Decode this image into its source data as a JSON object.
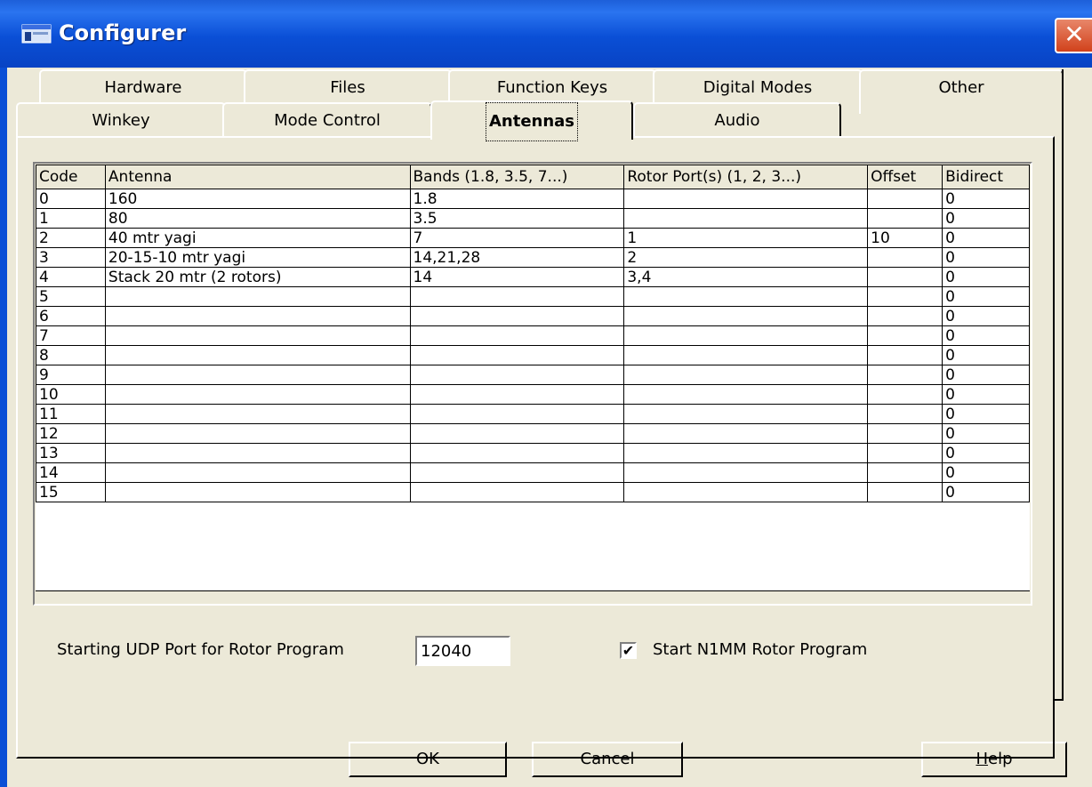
{
  "window": {
    "title": "Configurer",
    "close_glyph": "✕"
  },
  "tabs_row1": [
    {
      "label": "Hardware"
    },
    {
      "label": "Files"
    },
    {
      "label": "Function Keys"
    },
    {
      "label": "Digital Modes"
    },
    {
      "label": "Other"
    }
  ],
  "tabs_row2": [
    {
      "label": "Winkey"
    },
    {
      "label": "Mode Control"
    },
    {
      "label": "Antennas",
      "active": true
    },
    {
      "label": "Audio"
    }
  ],
  "grid": {
    "columns": [
      "Code",
      "Antenna",
      "Bands (1.8, 3.5, 7...)",
      "Rotor Port(s) (1, 2, 3...)",
      "Offset",
      "Bidirect"
    ],
    "rows": [
      [
        "0",
        "160",
        "1.8",
        "",
        "",
        "0"
      ],
      [
        "1",
        "80",
        "3.5",
        "",
        "",
        "0"
      ],
      [
        "2",
        "40 mtr yagi",
        "7",
        "1",
        "10",
        "0"
      ],
      [
        "3",
        "20-15-10 mtr yagi",
        "14,21,28",
        "2",
        "",
        "0"
      ],
      [
        "4",
        "Stack 20 mtr (2 rotors)",
        "14",
        "3,4",
        "",
        "0"
      ],
      [
        "5",
        "",
        "",
        "",
        "",
        "0"
      ],
      [
        "6",
        "",
        "",
        "",
        "",
        "0"
      ],
      [
        "7",
        "",
        "",
        "",
        "",
        "0"
      ],
      [
        "8",
        "",
        "",
        "",
        "",
        "0"
      ],
      [
        "9",
        "",
        "",
        "",
        "",
        "0"
      ],
      [
        "10",
        "",
        "",
        "",
        "",
        "0"
      ],
      [
        "11",
        "",
        "",
        "",
        "",
        "0"
      ],
      [
        "12",
        "",
        "",
        "",
        "",
        "0"
      ],
      [
        "13",
        "",
        "",
        "",
        "",
        "0"
      ],
      [
        "14",
        "",
        "",
        "",
        "",
        "0"
      ],
      [
        "15",
        "",
        "",
        "",
        "",
        "0"
      ]
    ]
  },
  "udp": {
    "label": "Starting UDP Port for Rotor Program",
    "value": "12040"
  },
  "rotor_program": {
    "label": "Start N1MM Rotor Program",
    "checked": true,
    "check_glyph": "✔"
  },
  "buttons": {
    "ok": "OK",
    "cancel": "Cancel",
    "help_first": "H",
    "help_rest": "elp"
  },
  "colors": {
    "titlebar": "#0a4fd6",
    "close": "#d1411b",
    "face": "#ece9d8"
  }
}
